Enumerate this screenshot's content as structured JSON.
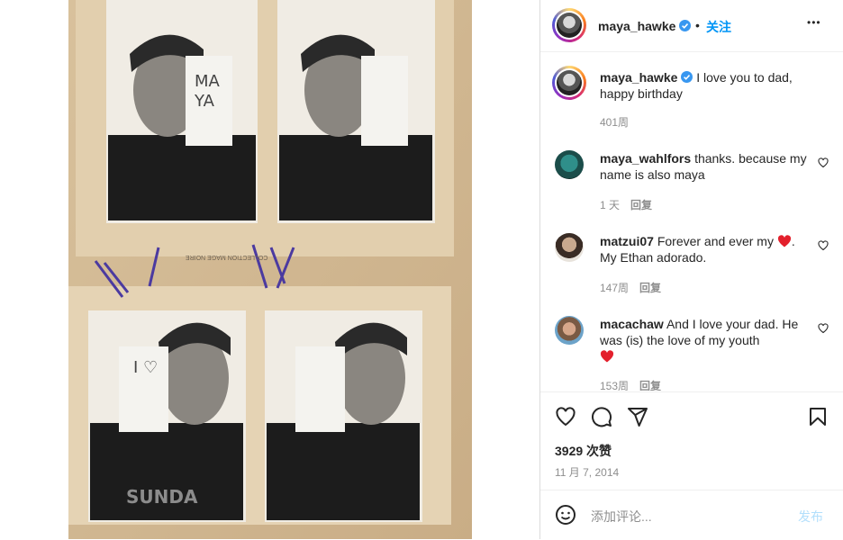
{
  "post": {
    "username": "maya_hawke",
    "follow_label": "关注",
    "dot": "•",
    "more": "•••",
    "caption": "I love you to dad, happy birthday",
    "caption_time": "401周"
  },
  "photo": {
    "top_sign_text": "MAYA",
    "bottom_sign_text": "I ♡",
    "shirt_text": "SUNDA",
    "strip_text": "COLLECTION MAGE NOIRE"
  },
  "comments": [
    {
      "username": "maya_wahlfors",
      "text": "thanks. because my name is also maya",
      "time": "1 天",
      "reply": "回复"
    },
    {
      "username": "matzui07",
      "text_before": "Forever and ever my",
      "text_after": ". My Ethan adorado.",
      "time": "147周",
      "reply": "回复"
    },
    {
      "username": "macachaw",
      "text": "And I love your dad. He was (is) the love of my youth",
      "time": "153周",
      "reply": "回复"
    }
  ],
  "stats": {
    "likes": "3929 次赞",
    "date": "11 月 7, 2014"
  },
  "add_comment": {
    "placeholder": "添加评论...",
    "post_label": "发布"
  },
  "colors": {
    "accent": "#0095f6",
    "heart_red": "#ed4956",
    "verified_blue": "#3897f0"
  },
  "icons": [
    "verified-icon",
    "more-icon",
    "heart-icon",
    "comment-icon",
    "share-icon",
    "bookmark-icon",
    "emoji-icon"
  ]
}
